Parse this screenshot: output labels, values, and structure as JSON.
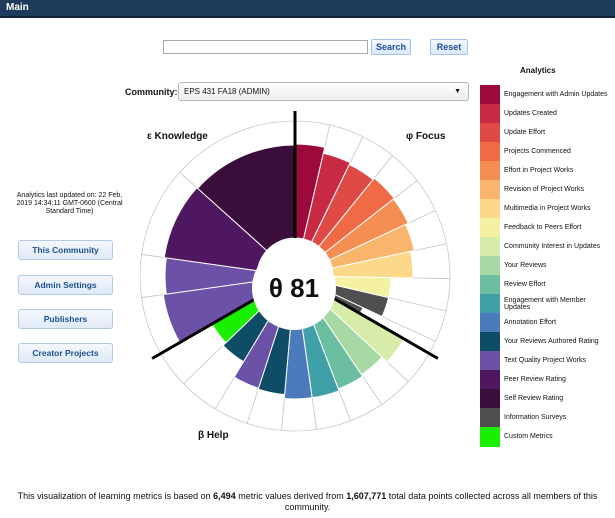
{
  "header": {
    "title": "Main"
  },
  "search": {
    "placeholder": "",
    "search_label": "Search",
    "reset_label": "Reset"
  },
  "community": {
    "label": "Community:",
    "selected": "EPS 431 FA18 (ADMIN)"
  },
  "updated_text": "Analytics last updated on: 22 Feb, 2019 14:34:11 GMT-0600 (Central Standard Time)",
  "side_buttons": [
    "This Community",
    "Admin Settings",
    "Publishers",
    "Creator Projects"
  ],
  "chart": {
    "center_value": "θ 81",
    "labels": {
      "knowledge": "ε Knowledge",
      "focus": "φ Focus",
      "help": "β Help"
    }
  },
  "legend": {
    "title": "Analytics",
    "items": [
      {
        "label": "Engagement with Admin Updates",
        "color": "#9b0a3a"
      },
      {
        "label": "Updates Created",
        "color": "#c92a43"
      },
      {
        "label": "Update Effort",
        "color": "#df4a46"
      },
      {
        "label": "Projects Commenced",
        "color": "#ef6a45"
      },
      {
        "label": "Effort in Project Works",
        "color": "#f58e52"
      },
      {
        "label": "Revision of Project Works",
        "color": "#f9b56c"
      },
      {
        "label": "Multimedia in Project Works",
        "color": "#fbd88a"
      },
      {
        "label": "Feedback to Peers Effort",
        "color": "#f4f2a2"
      },
      {
        "label": "Community Interest in Updates",
        "color": "#d8ecaa"
      },
      {
        "label": "Your Reviews",
        "color": "#a8d9a4"
      },
      {
        "label": "Review Effort",
        "color": "#6bbfa0"
      },
      {
        "label": "Engagement with Member Updates",
        "color": "#3fa0a7"
      },
      {
        "label": "Annotation Effort",
        "color": "#4b7bbb"
      },
      {
        "label": "Your Reviews Authored Rating",
        "color": "#0f4d66"
      },
      {
        "label": "Text Quality Project Works",
        "color": "#6b52a6"
      },
      {
        "label": "Peer Review Rating",
        "color": "#4e1760"
      },
      {
        "label": "Self Review Rating",
        "color": "#3a0d3a"
      },
      {
        "label": "Information Surveys",
        "color": "#4f4f4f"
      },
      {
        "label": "Custom Metrics",
        "color": "#19f000"
      }
    ]
  },
  "footer": {
    "before": "This visualization of learning metrics is based on ",
    "metric_count": "6,494",
    "middle": " metric values derived from ",
    "data_points": "1,607,771",
    "after": " total data points collected across all members of this community."
  }
}
